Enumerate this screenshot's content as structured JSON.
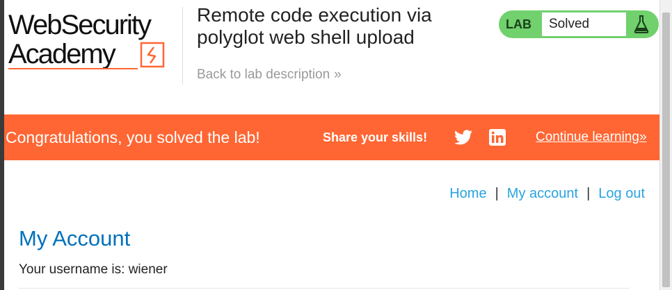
{
  "header": {
    "logo_line1": "WebSecurity",
    "logo_line2": "Academy",
    "lab_title": "Remote code execution via polyglot web shell upload",
    "back_link": "Back to lab description",
    "back_chevron": "»",
    "lab_badge_label": "LAB",
    "lab_status": "Solved",
    "brand_color": "#ff6633",
    "status_color": "#70d16d"
  },
  "banner": {
    "message": "Congratulations, you solved the lab!",
    "share": "Share your skills!",
    "twitter_icon": "twitter-icon",
    "linkedin_icon": "linkedin-icon",
    "continue": "Continue learning",
    "continue_chevron": "»"
  },
  "nav": {
    "home": "Home",
    "sep1": "|",
    "my_account": "My account",
    "sep2": "|",
    "log_out": "Log out"
  },
  "main": {
    "title": "My Account",
    "username_label": "Your username is: wiener"
  }
}
